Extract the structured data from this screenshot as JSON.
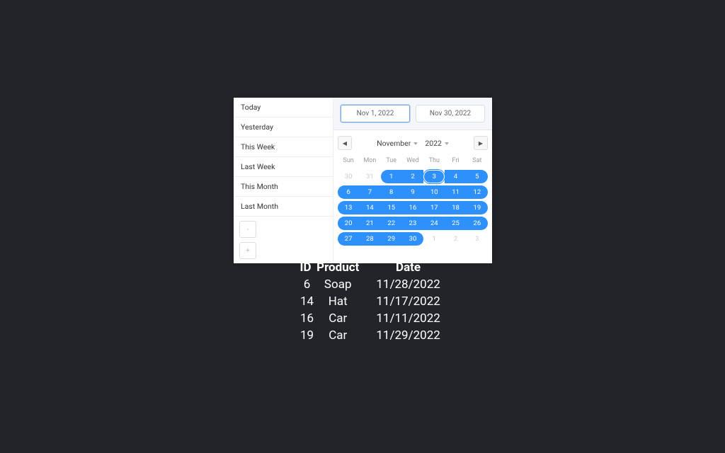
{
  "presets": [
    "Today",
    "Yesterday",
    "This Week",
    "Last Week",
    "This Month",
    "Last Month"
  ],
  "range": {
    "start": "Nov 1, 2022",
    "end": "Nov 30, 2022"
  },
  "nav": {
    "month": "November",
    "year": "2022"
  },
  "weekdays": [
    "Sun",
    "Mon",
    "Tue",
    "Wed",
    "Thu",
    "Fri",
    "Sat"
  ],
  "days": [
    {
      "n": "30",
      "muted": true,
      "sel": false
    },
    {
      "n": "31",
      "muted": true,
      "sel": false
    },
    {
      "n": "1",
      "sel": true,
      "start": true
    },
    {
      "n": "2",
      "sel": true
    },
    {
      "n": "3",
      "sel": true,
      "focus": true
    },
    {
      "n": "4",
      "sel": true
    },
    {
      "n": "5",
      "sel": true,
      "end": true
    },
    {
      "n": "6",
      "sel": true,
      "start": true
    },
    {
      "n": "7",
      "sel": true
    },
    {
      "n": "8",
      "sel": true
    },
    {
      "n": "9",
      "sel": true
    },
    {
      "n": "10",
      "sel": true
    },
    {
      "n": "11",
      "sel": true
    },
    {
      "n": "12",
      "sel": true,
      "end": true
    },
    {
      "n": "13",
      "sel": true,
      "start": true
    },
    {
      "n": "14",
      "sel": true
    },
    {
      "n": "15",
      "sel": true
    },
    {
      "n": "16",
      "sel": true
    },
    {
      "n": "17",
      "sel": true
    },
    {
      "n": "18",
      "sel": true
    },
    {
      "n": "19",
      "sel": true,
      "end": true
    },
    {
      "n": "20",
      "sel": true,
      "start": true
    },
    {
      "n": "21",
      "sel": true
    },
    {
      "n": "22",
      "sel": true
    },
    {
      "n": "23",
      "sel": true
    },
    {
      "n": "24",
      "sel": true
    },
    {
      "n": "25",
      "sel": true
    },
    {
      "n": "26",
      "sel": true,
      "end": true
    },
    {
      "n": "27",
      "sel": true,
      "start": true
    },
    {
      "n": "28",
      "sel": true
    },
    {
      "n": "29",
      "sel": true
    },
    {
      "n": "30",
      "sel": true,
      "end": true
    },
    {
      "n": "1",
      "muted": true,
      "sel": false
    },
    {
      "n": "2",
      "muted": true,
      "sel": false
    },
    {
      "n": "3",
      "muted": true,
      "sel": false
    }
  ],
  "table": {
    "headers": [
      "ID",
      "Product",
      "Date"
    ],
    "rows": [
      {
        "id": "6",
        "product": "Soap",
        "date": "11/28/2022"
      },
      {
        "id": "14",
        "product": "Hat",
        "date": "11/17/2022"
      },
      {
        "id": "16",
        "product": "Car",
        "date": "11/11/2022"
      },
      {
        "id": "19",
        "product": "Car",
        "date": "11/29/2022"
      }
    ]
  }
}
